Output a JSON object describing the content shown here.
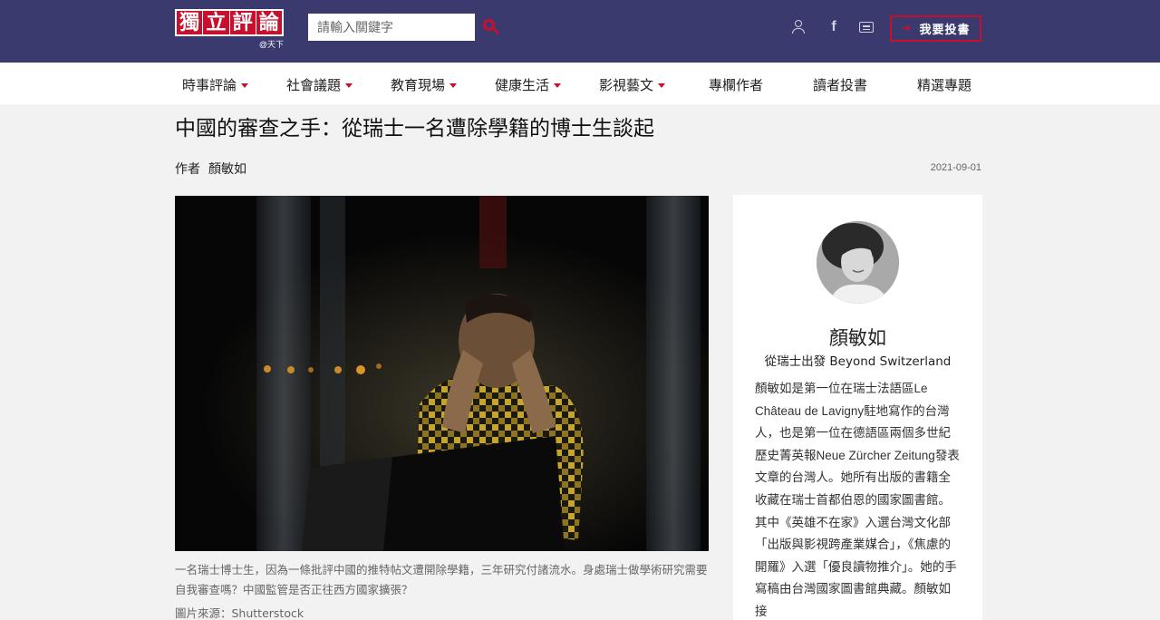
{
  "header": {
    "logo_chars": [
      "獨",
      "立",
      "評",
      "論"
    ],
    "logo_sub": "@天下",
    "search_placeholder": "請輸入關鍵字",
    "submit_label": "我要投書",
    "icons": [
      "search-icon",
      "user-icon",
      "facebook-icon",
      "rss-icon"
    ]
  },
  "nav": [
    {
      "label": "時事評論",
      "dropdown": true
    },
    {
      "label": "社會議題",
      "dropdown": true
    },
    {
      "label": "教育現場",
      "dropdown": true
    },
    {
      "label": "健康生活",
      "dropdown": true
    },
    {
      "label": "影視藝文",
      "dropdown": true
    },
    {
      "label": "專欄作者",
      "dropdown": false
    },
    {
      "label": "讀者投書",
      "dropdown": false
    },
    {
      "label": "精選專題",
      "dropdown": false
    }
  ],
  "article": {
    "title": "中國的審查之手：從瑞士一名遭除學籍的博士生談起",
    "author_prefix": "作者",
    "author": "顏敏如",
    "date": "2021-09-01",
    "caption": "一名瑞士博士生，因為一條批評中國的推特帖文遭開除學籍，三年研究付諸流水。身處瑞士做學術研究需要自我審查嗎？中國監管是否正往西方國家擴張？",
    "image_credit": "圖片來源：Shutterstock"
  },
  "sidebar": {
    "name": "顏敏如",
    "column": "從瑞士出發 Beyond Switzerland",
    "bio": "顏敏如是第一位在瑞士法語區Le Château de Lavigny駐地寫作的台灣人，也是第一位在德語區兩個多世紀歷史菁英報Neue Zürcher Zeitung發表文章的台灣人。她所有出版的書籍全收藏在瑞士首都伯恩的國家圖書館。其中《英雄不在家》入選台灣文化部「出版與影視跨產業媒合」，《焦慮的開羅》入選「優良讀物推介」。她的手寫稿由台灣國家圖書館典藏。顏敏如接"
  },
  "colors": {
    "header_bg": "#3b3a6e",
    "accent": "#c8102e"
  }
}
